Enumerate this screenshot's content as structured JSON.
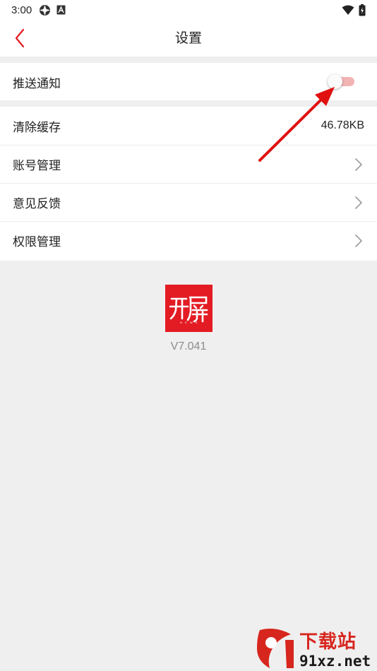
{
  "status_bar": {
    "time": "3:00",
    "left_icons": [
      "status-ring-icon",
      "font-a-icon"
    ],
    "right_icons": [
      "wifi-icon",
      "battery-icon"
    ]
  },
  "header": {
    "title": "设置",
    "back_icon": "back-chevron-icon"
  },
  "settings": {
    "push": {
      "label": "推送通知",
      "toggle_on": false
    },
    "items": [
      {
        "label": "清除缓存",
        "value": "46.78KB"
      },
      {
        "label": "账号管理",
        "icon": "chevron-right-icon"
      },
      {
        "label": "意见反馈",
        "icon": "chevron-right-icon"
      },
      {
        "label": "权限管理",
        "icon": "chevron-right-icon"
      }
    ]
  },
  "about": {
    "logo_text": "开屏",
    "version": "V7.041"
  },
  "watermark": {
    "top": "下载站",
    "bottom": "91xz.net"
  },
  "colors": {
    "accent": "#e31b23",
    "toggle_track_off": "#f2b3b3",
    "background": "#efefef",
    "card": "#ffffff",
    "version_text": "#8c8c8c"
  }
}
